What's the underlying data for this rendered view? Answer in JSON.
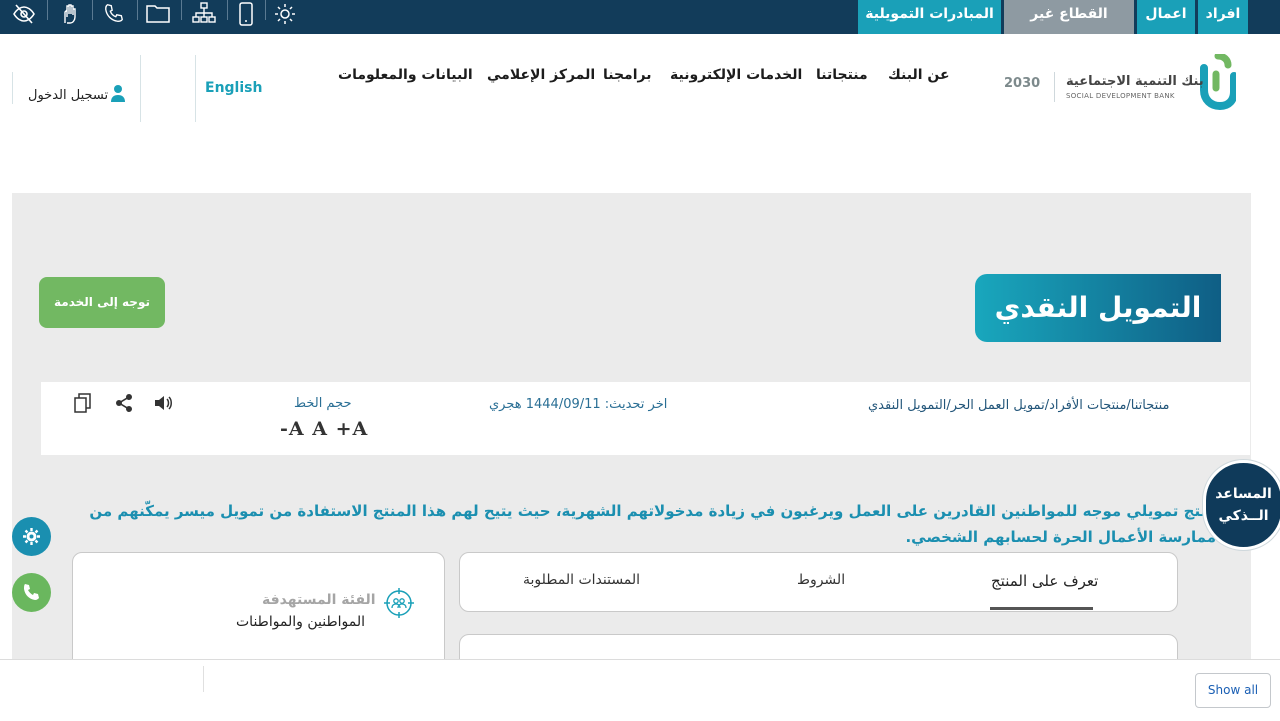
{
  "topbar": {
    "tabs": {
      "individuals": "افراد",
      "business": "اعمال",
      "nonprofit": "القطاع غير الربحي",
      "initiatives": "المبادرات التمويلية"
    },
    "icons": [
      "eye-slash-icon",
      "sign-language-icon",
      "phone-icon",
      "folder-icon",
      "sitemap-icon",
      "mobile-icon",
      "gear-icon"
    ],
    "colors": {
      "bar": "#123c5a",
      "individuals": "#1aa0b8",
      "business": "#1aa0b8",
      "nonprofit": "#8e9aa2",
      "initiatives": "#1aa0b8"
    }
  },
  "header": {
    "bank_name_ar": "بنك التنمية الاجتماعية",
    "bank_name_en": "SOCIAL DEVELOPMENT BANK",
    "vision": "2030",
    "nav": {
      "about": "عن البنك",
      "products": "منتجاتنا",
      "eservices": "الخدمات الإلكترونية",
      "programs": "برامجنا",
      "media": "المركز الإعلامي",
      "data": "البيانات والمعلومات"
    },
    "language": "English",
    "login": "تسجيل الدخول"
  },
  "hero": {
    "title": "التمويل النقدي",
    "service_button": "توجه إلى الخدمة"
  },
  "info_bar": {
    "breadcrumb": "منتجاتنا/منتجات الأفراد/تمويل العمل الحر/التمويل النقدي",
    "last_update": "اخر تحديث: 1444/09/11 هجري",
    "font_size_label": "حجم الخط",
    "font_size_controls": "-A A +A",
    "icons": [
      "speaker-icon",
      "share-icon",
      "copy-icon"
    ]
  },
  "description": "منتج تمويلي موجه للمواطنين القادرين على العمل ويرغبون في زيادة مدخولاتهم الشهرية، حيث يتيح لهم هذا المنتج الاستفادة من تمويل ميسر يمكّنهم من ممارسة الأعمال الحرة لحسابهم الشخصي.",
  "target_group": {
    "title": "الفئة المستهدفة",
    "value": "المواطنين والمواطنات"
  },
  "tabs": {
    "about_product": "تعرف على المنتج",
    "terms": "الشروط",
    "documents": "المستندات المطلوبة"
  },
  "assistant": {
    "line1": "المساعد",
    "line2": "الــذكي"
  },
  "bottom": {
    "show_all": "Show all"
  }
}
